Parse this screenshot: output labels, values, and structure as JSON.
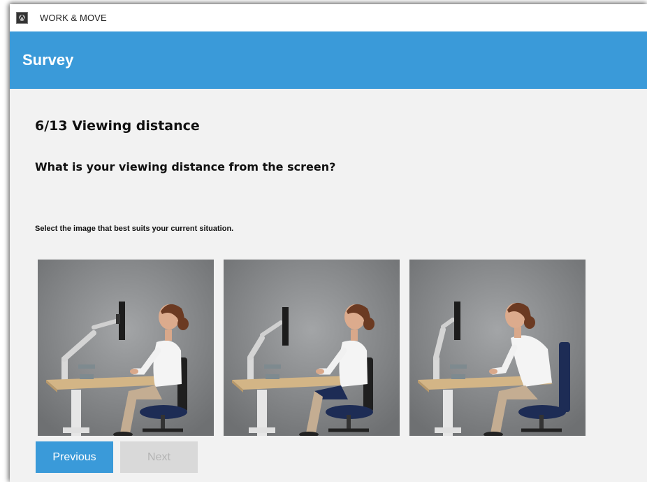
{
  "window": {
    "app_title": "WORK & MOVE",
    "app_icon": "work-and-move-logo-icon"
  },
  "header": {
    "title": "Survey"
  },
  "survey": {
    "step_title": "6/13 Viewing distance",
    "question": "What is your viewing distance from the screen?",
    "instruction": "Select the image that best suits your current situation.",
    "options": [
      {
        "description": "Seated upright, far from monitor"
      },
      {
        "description": "Seated upright, medium distance to monitor"
      },
      {
        "description": "Leaning forward, close to monitor"
      }
    ]
  },
  "navigation": {
    "previous_label": "Previous",
    "next_label": "Next",
    "next_enabled": false
  },
  "colors": {
    "accent": "#3a9ad9",
    "disabled_button": "#d9d9d9",
    "disabled_text": "#b4b4b4",
    "background": "#f2f2f2"
  }
}
